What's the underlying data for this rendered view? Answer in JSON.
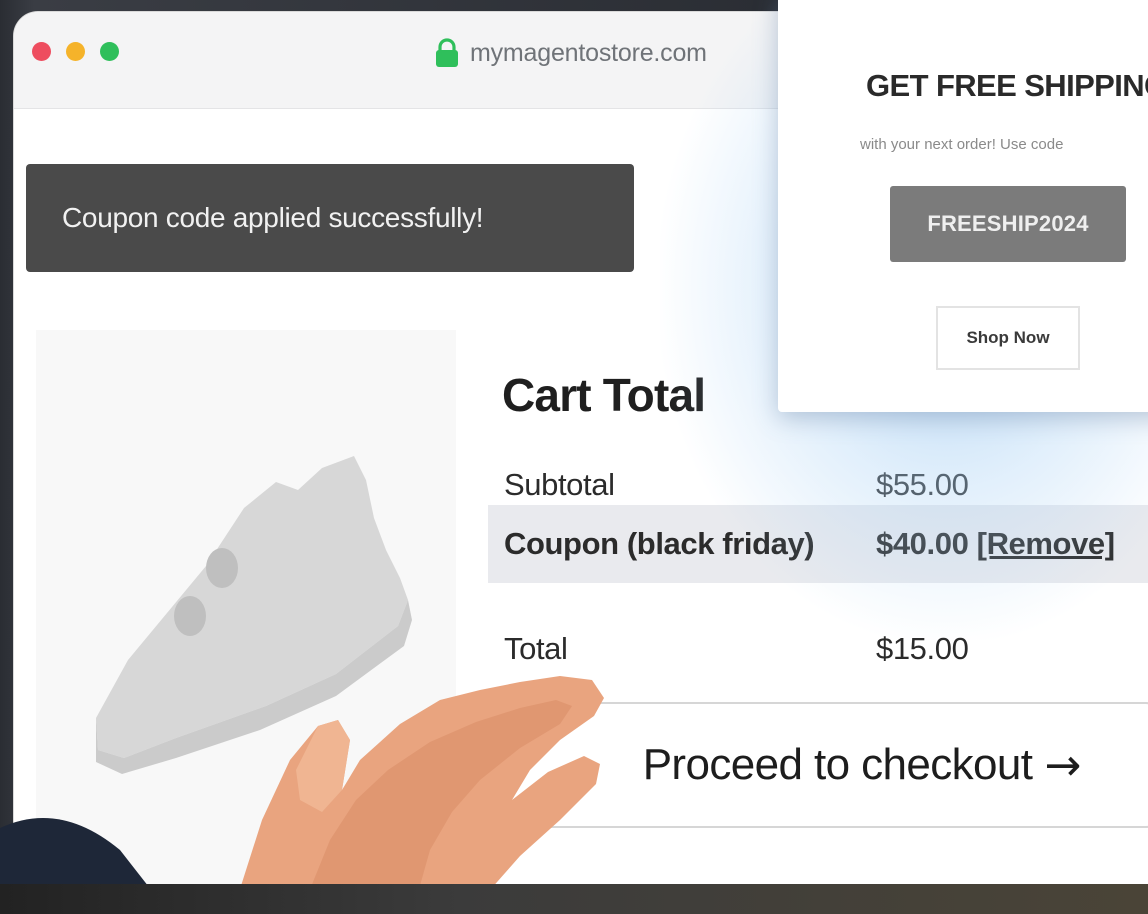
{
  "browser": {
    "url": "mymagentostore.com"
  },
  "toast": {
    "message": "Coupon code applied successfully!"
  },
  "cart": {
    "title": "Cart Total",
    "rows": [
      {
        "label": "Subtotal",
        "value": "$55.00"
      },
      {
        "label": "Coupon (black friday)",
        "value": "$40.00",
        "action": "[Remove]"
      },
      {
        "label": "Total",
        "value": "$15.00"
      }
    ],
    "checkout_label": "Proceed to checkout",
    "checkout_arrow": "→"
  },
  "popup": {
    "title": "GET FREE SHIPPING",
    "subtitle": "with your next order! Use code",
    "code": "FREESHIP2024",
    "button": "Shop Now"
  },
  "colors": {
    "toast_bg": "#4a4a4a",
    "coupon_row_bg": "#e9eaee",
    "coupon_box_bg": "#7b7b7b",
    "dot_red": "#ee4d5f",
    "dot_yellow": "#f5b32a",
    "dot_green": "#2fbf5b",
    "lock_green": "#2fbf5b"
  },
  "icons": {
    "lock": "lock-icon",
    "arrow": "arrow-right-icon",
    "product": "sneaker-image"
  }
}
